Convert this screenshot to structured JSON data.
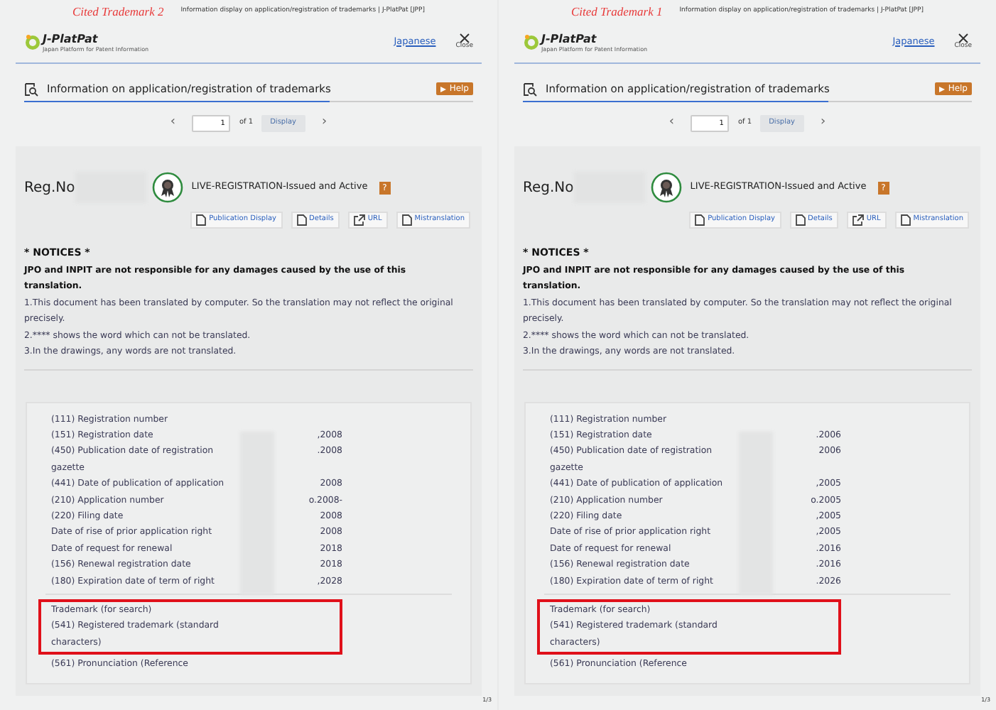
{
  "panels": [
    {
      "caption": "Cited Trademark 2",
      "tab_title": "Information display on application/registration of trademarks | J-PlatPat [JPP]",
      "logo": {
        "name": "J-PlatPat",
        "tagline": "Japan Platform for Patent Information"
      },
      "language_link": "Japanese",
      "close_label": "Close",
      "heading": "Information on application/registration of trademarks",
      "help_label": "Help",
      "pager": {
        "prev": "‹",
        "page": "1",
        "of_label": "of 1",
        "display_label": "Display",
        "next": "›"
      },
      "reg_label": "Reg.No",
      "status": "LIVE-REGISTRATION-Issued and Active",
      "help_mark": "?",
      "buttons": [
        {
          "kind": "document",
          "label": "Publication Display"
        },
        {
          "kind": "document",
          "label": "Details"
        },
        {
          "kind": "link",
          "label": "URL"
        },
        {
          "kind": "document",
          "label": "Mistranslation"
        }
      ],
      "notices": {
        "title": "* NOTICES *",
        "disclaimer": "JPO and INPIT are not responsible for any damages caused by the use of this translation.",
        "items": [
          "1.This document has been translated by computer. So the translation may not reflect the original precisely.",
          "2.**** shows the word which can not be translated.",
          "3.In the drawings, any words are not translated."
        ]
      },
      "fields": [
        {
          "label": "(111) Registration number"
        },
        {
          "label": "(151) Registration date",
          "value": ",2008"
        },
        {
          "label": "(450) Publication date of registration gazette",
          "value": ".2008"
        },
        {
          "label": "(441) Date of publication of application",
          "value": "2008"
        },
        {
          "label": "(210) Application number",
          "value": "o.2008-"
        },
        {
          "label": "(220) Filing date",
          "value": "2008"
        },
        {
          "label": "Date of rise of prior application right",
          "value": "2008"
        },
        {
          "label": "Date of request for renewal",
          "value": "2018"
        },
        {
          "label": "(156) Renewal registration date",
          "value": "2018"
        },
        {
          "label": "(180) Expiration date of term of right",
          "value": ",2028"
        }
      ],
      "highlighted_fields": [
        "Trademark (for search)",
        "(541) Registered trademark (standard characters)"
      ],
      "last_field": "(561) Pronunciation (Reference",
      "page_number": "1/3"
    },
    {
      "caption": "Cited Trademark 1",
      "tab_title": "Information display on application/registration of trademarks | J-PlatPat [JPP]",
      "logo": {
        "name": "J-PlatPat",
        "tagline": "Japan Platform for Patent Information"
      },
      "language_link": "Japanese",
      "close_label": "Close",
      "heading": "Information on application/registration of trademarks",
      "help_label": "Help",
      "pager": {
        "prev": "‹",
        "page": "1",
        "of_label": "of 1",
        "display_label": "Display",
        "next": "›"
      },
      "reg_label": "Reg.No",
      "status": "LIVE-REGISTRATION-Issued and Active",
      "help_mark": "?",
      "buttons": [
        {
          "kind": "document",
          "label": "Publication Display"
        },
        {
          "kind": "document",
          "label": "Details"
        },
        {
          "kind": "link",
          "label": "URL"
        },
        {
          "kind": "document",
          "label": "Mistranslation"
        }
      ],
      "notices": {
        "title": "* NOTICES *",
        "disclaimer": "JPO and INPIT are not responsible for any damages caused by the use of this translation.",
        "items": [
          "1.This document has been translated by computer. So the translation may not reflect the original precisely.",
          "2.**** shows the word which can not be translated.",
          "3.In the drawings, any words are not translated."
        ]
      },
      "fields": [
        {
          "label": "(111) Registration number"
        },
        {
          "label": "(151) Registration date",
          "value": ".2006"
        },
        {
          "label": "(450) Publication date of registration gazette",
          "value": "2006"
        },
        {
          "label": "(441) Date of publication of application",
          "value": ",2005"
        },
        {
          "label": "(210) Application number",
          "value": "o.2005"
        },
        {
          "label": "(220) Filing date",
          "value": ",2005"
        },
        {
          "label": "Date of rise of prior application right",
          "value": ",2005"
        },
        {
          "label": "Date of request for renewal",
          "value": ".2016"
        },
        {
          "label": "(156) Renewal registration date",
          "value": ".2016"
        },
        {
          "label": "(180) Expiration date of term of right",
          "value": ".2026"
        }
      ],
      "highlighted_fields": [
        "Trademark (for search)",
        "(541) Registered trademark (standard characters)"
      ],
      "last_field": "(561) Pronunciation (Reference",
      "page_number": "1/3"
    }
  ]
}
